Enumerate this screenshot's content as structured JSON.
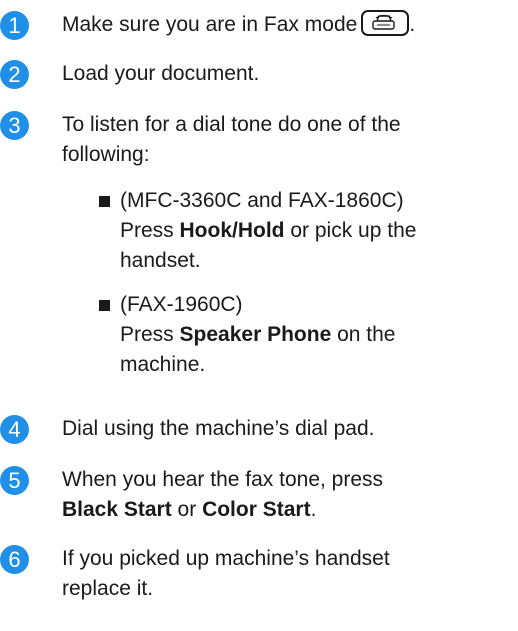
{
  "steps": [
    {
      "number": "1",
      "lines": [
        "Make sure you are in Fax mode"
      ],
      "suffix": "."
    },
    {
      "number": "2",
      "lines": [
        "Load your document."
      ]
    },
    {
      "number": "3",
      "lines": [
        "To listen for a dial tone do one of the",
        "following:"
      ]
    },
    {
      "number": "4",
      "lines": [
        "Dial using the machine’s dial pad."
      ]
    },
    {
      "number": "5",
      "line1": "When you hear the fax tone, press",
      "bold_a": "Black Start",
      "mid": " or ",
      "bold_b": "Color Start",
      "end": "."
    },
    {
      "number": "6",
      "lines": [
        "If you picked up machine’s handset",
        "replace it."
      ]
    }
  ],
  "bullets": [
    {
      "line1": "(MFC-3360C and FAX-1860C)",
      "pre": "Press ",
      "bold": "Hook/Hold",
      "post": " or pick up the",
      "line3": "handset."
    },
    {
      "line1": "(FAX-1960C)",
      "pre": "Press ",
      "bold": "Speaker Phone",
      "post": " on the",
      "line3": "machine."
    }
  ],
  "icons": {
    "step_marker": "numbered-circle",
    "fax_mode_key": "fax-icon",
    "bullet": "square-bullet"
  },
  "colors": {
    "accent": "#1f8fe8",
    "text": "#1a1a1a"
  }
}
